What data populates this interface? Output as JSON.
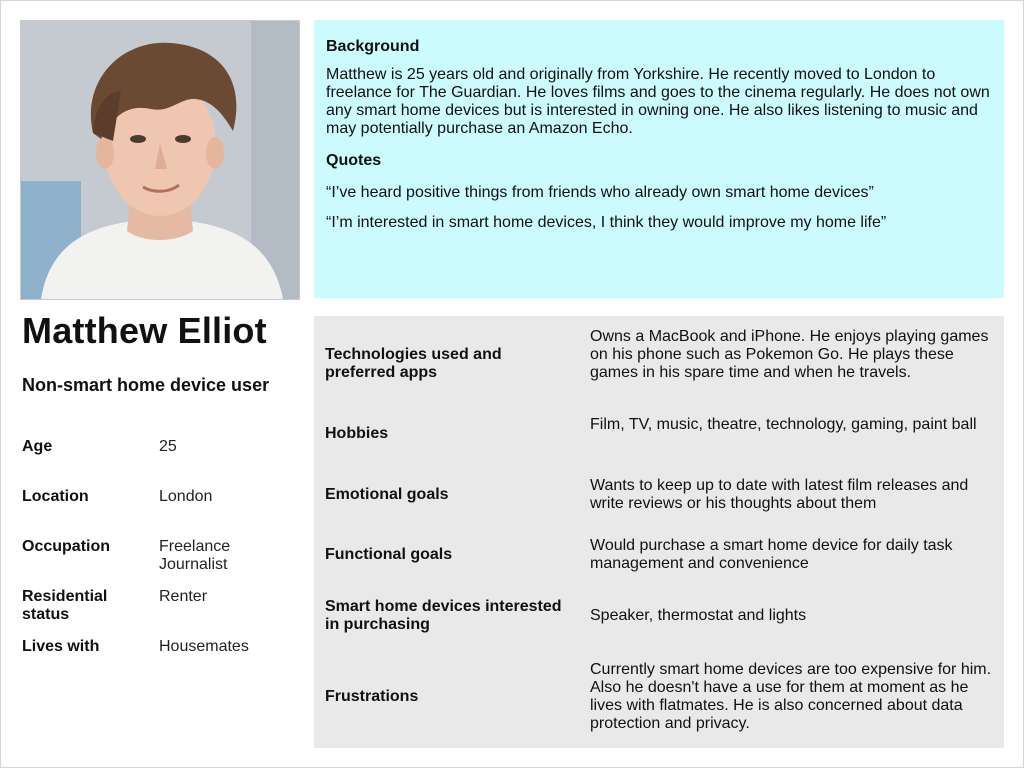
{
  "persona": {
    "name": "Matthew Elliot",
    "subtitle": "Non-smart home device user"
  },
  "background": {
    "heading": "Background",
    "text": "Matthew is 25 years old and originally from Yorkshire. He recently moved to London to freelance for The Guardian. He loves films and goes to the cinema regularly. He does not own any smart home devices but is interested in owning one. He also likes listening to music and may potentially purchase an Amazon Echo.",
    "quotes_heading": "Quotes",
    "quotes": [
      "“I’ve heard positive things from friends who already own smart home devices”",
      "“I’m interested in smart home devices, I think they would improve my home life”"
    ]
  },
  "demographics": [
    {
      "label": "Age",
      "value": "25"
    },
    {
      "label": "Location",
      "value": "London"
    },
    {
      "label": "Occupation",
      "value": "Freelance Journalist"
    },
    {
      "label": "Residential status",
      "value": "Renter"
    },
    {
      "label": "Lives with",
      "value": "Housemates"
    }
  ],
  "details": [
    {
      "label": "Technologies used and preferred apps",
      "value": "Owns a MacBook and iPhone. He enjoys playing games on his phone such as Pokemon Go. He plays these games in his spare time and when he travels."
    },
    {
      "label": "Hobbies",
      "value": "Film, TV, music, theatre, technology, gaming, paint ball"
    },
    {
      "label": "Emotional goals",
      "value": "Wants to keep up to date with latest film releases and write reviews or his thoughts about them"
    },
    {
      "label": "Functional goals",
      "value": "Would purchase a smart home device for daily task management and convenience"
    },
    {
      "label": "Smart home devices interested in purchasing",
      "value": "Speaker, thermostat and lights"
    },
    {
      "label": "Frustrations",
      "value": "Currently smart home devices are too expensive for him. Also he doesn't have a use for them at moment as he lives with flatmates. He is also concerned about data protection and privacy."
    }
  ],
  "colors": {
    "background_panel": "#ccfbfd",
    "details_panel": "#e9e9e9"
  }
}
